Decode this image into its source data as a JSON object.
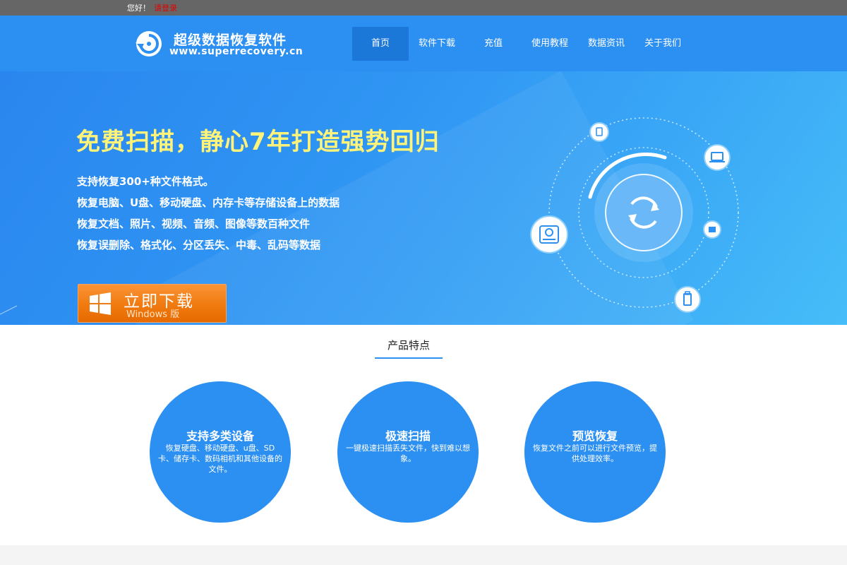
{
  "topbar": {
    "greeting": "您好！",
    "login_link": "请登录"
  },
  "header": {
    "logo_title": "超级数据恢复软件",
    "logo_url": "www.superrecovery.cn",
    "nav": [
      {
        "label": "首页",
        "active": true
      },
      {
        "label": "软件下载",
        "active": false
      },
      {
        "label": "充值",
        "active": false
      },
      {
        "label": "使用教程",
        "active": false
      },
      {
        "label": "数据资讯",
        "active": false
      },
      {
        "label": "关于我们",
        "active": false
      }
    ]
  },
  "hero": {
    "title": "免费扫描，静心7年打造强势回归",
    "lines": [
      "支持恢复300+种文件格式。",
      "恢复电脑、U盘、移动硬盘、内存卡等存储设备上的数据",
      "恢复文档、照片、视频、音频、图像等数百种文件",
      "恢复误删除、格式化、分区丢失、中毒、乱码等数据"
    ],
    "download_label": "立即下载",
    "download_sub": "Windows 版"
  },
  "features": {
    "section_title": "产品特点",
    "items": [
      {
        "title": "支持多类设备",
        "desc": "恢复硬盘、移动硬盘、u盘、SD卡、储存卡、数码相机和其他设备的文件。"
      },
      {
        "title": "极速扫描",
        "desc": "一键极速扫描丢失文件，快到难以想象。"
      },
      {
        "title": "预览恢复",
        "desc": "恢复文件之前可以进行文件预览，提供处理效率。"
      }
    ]
  },
  "colors": {
    "brand_blue": "#2c8ff2",
    "nav_active": "#1b78d9",
    "title_yellow": "#fff37a",
    "download_orange": "#f07a0f",
    "login_red": "#e30000"
  }
}
